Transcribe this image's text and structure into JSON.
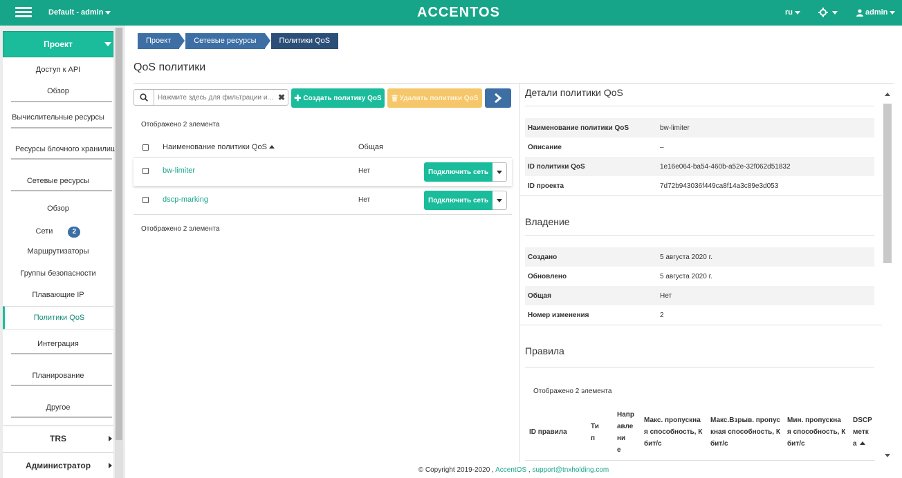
{
  "header": {
    "project_selector": "Default - admin",
    "logo": "ACCENTOS",
    "language": "ru",
    "user": "admin",
    "icons": [
      "menu-icon",
      "gear-icon",
      "user-icon"
    ]
  },
  "sidebar": {
    "project": "Проект",
    "items": [
      {
        "label": "Доступ к API"
      },
      {
        "label": "Обзор"
      },
      {
        "label": "Вычислительные ресурсы"
      },
      {
        "label": "Ресурсы блочного хранилища"
      },
      {
        "label": "Сетевые ресурсы"
      },
      {
        "label": "Обзор"
      },
      {
        "label": "Сети",
        "badge": "2"
      },
      {
        "label": "Маршрутизаторы"
      },
      {
        "label": "Группы безопасности"
      },
      {
        "label": "Плавающие IP"
      },
      {
        "label": "Политики QoS",
        "active": true
      },
      {
        "label": "Интеграция"
      },
      {
        "label": "Планирование"
      },
      {
        "label": "Другое"
      }
    ],
    "groups": [
      "TRS",
      "Администратор"
    ]
  },
  "breadcrumb": [
    "Проект",
    "Сетевые ресурсы",
    "Политики QoS"
  ],
  "page_title": "QoS политики",
  "toolbar": {
    "search_placeholder": "Нажмите здесь для фильтрации и...",
    "create_label": "Создать политику QoS",
    "delete_label": "Удалить политики QoS"
  },
  "table": {
    "count_top": "Отображено 2 элемента",
    "count_bottom": "Отображено 2 элемента",
    "columns": [
      "Наименование политики QoS",
      "Общая"
    ],
    "rows": [
      {
        "name": "bw-limiter",
        "shared": "Нет",
        "action": "Подключить сеть"
      },
      {
        "name": "dscp-marking",
        "shared": "Нет",
        "action": "Подключить сеть"
      }
    ]
  },
  "details": {
    "title": "Детали политики QoS",
    "fields": [
      {
        "label": "Наименование политики QoS",
        "value": "bw-limiter"
      },
      {
        "label": "Описание",
        "value": "–"
      },
      {
        "label": "ID политики QoS",
        "value": "1e16e064-ba54-460b-a52e-32f062d51832"
      },
      {
        "label": "ID проекта",
        "value": "7d72b943036f449ca8f14a3c89e3d053"
      }
    ],
    "ownership_title": "Владение",
    "ownership": [
      {
        "label": "Создано",
        "value": "5 августа 2020 г."
      },
      {
        "label": "Обновлено",
        "value": "5 августа 2020 г."
      },
      {
        "label": "Общая",
        "value": "Нет"
      },
      {
        "label": "Номер изменения",
        "value": "2"
      }
    ],
    "rules_title": "Правила",
    "rules_count": "Отображено 2 элемента",
    "rules_columns": [
      "ID правила",
      "Ти\nп",
      "Напр\nавле\nни\nе",
      "Макс. пропускна\nя способность, К\nбит/с",
      "Макс.Взрыв. пропус\nкная способность, К\nбит/с",
      "Мин. пропускна\nя способность, К\nбит/с",
      "DSCP\nметк\nа"
    ]
  },
  "footer": {
    "copyright": "© Copyright 2019-2020 ,",
    "brand_link": "AccentOS",
    "separator": ",",
    "support_link": "support@tnxholding.com"
  },
  "colors": {
    "primary": "#17a589",
    "accent": "#1abc9c",
    "blue": "#3d6fa5",
    "warning": "#f5c76a"
  }
}
